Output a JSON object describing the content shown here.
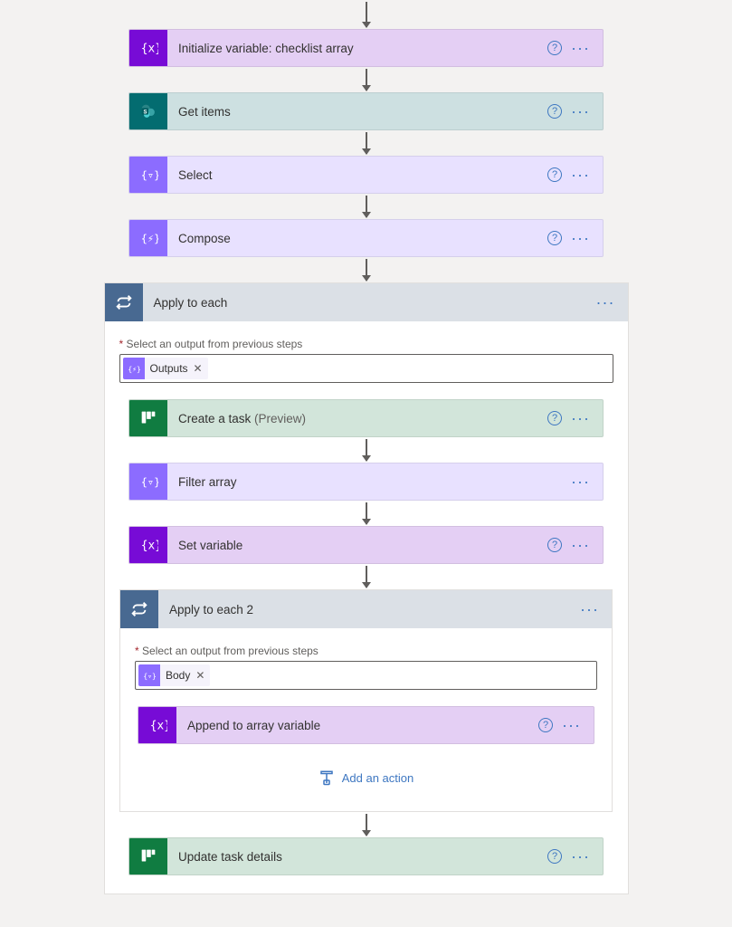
{
  "flow": {
    "steps": [
      {
        "id": "init_var",
        "label": "Initialize variable: checklist array"
      },
      {
        "id": "get_items",
        "label": "Get items"
      },
      {
        "id": "select",
        "label": "Select"
      },
      {
        "id": "compose",
        "label": "Compose"
      }
    ],
    "apply_to_each": {
      "label": "Apply to each",
      "field_label": "Select an output from previous steps",
      "token": {
        "label": "Outputs"
      },
      "steps": [
        {
          "id": "create_task",
          "label": "Create a task ",
          "suffix": "(Preview)"
        },
        {
          "id": "filter_array",
          "label": "Filter array"
        },
        {
          "id": "set_var",
          "label": "Set variable"
        }
      ],
      "apply_to_each_2": {
        "label": "Apply to each 2",
        "field_label": "Select an output from previous steps",
        "token": {
          "label": "Body"
        },
        "steps": [
          {
            "id": "append_array",
            "label": "Append to array variable"
          }
        ],
        "add_action_label": "Add an action"
      },
      "after_step": {
        "id": "update_task",
        "label": "Update task details"
      }
    }
  }
}
